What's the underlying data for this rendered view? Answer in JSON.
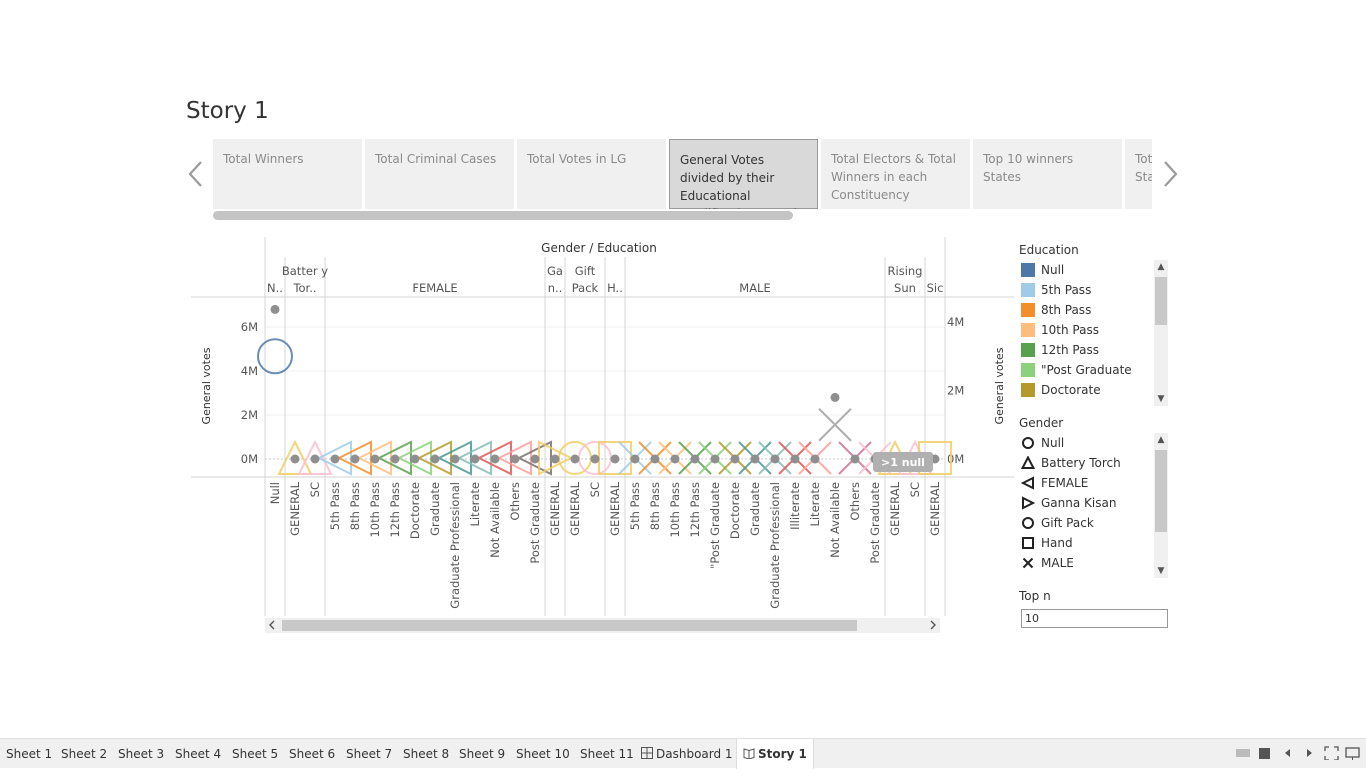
{
  "story": {
    "title": "Story 1",
    "points": [
      {
        "label": "Total Winners"
      },
      {
        "label": "Total Criminal Cases"
      },
      {
        "label": "Total Votes in LG"
      },
      {
        "label": "General Votes divided by their Educational Qualification&Gender"
      },
      {
        "label": " Total Electors & Total Winners in each Constituency"
      },
      {
        "label": "Top 10 winners States"
      },
      {
        "label": "Total General ... States"
      }
    ],
    "active_index": 3
  },
  "viz": {
    "column_header": "Gender / Education",
    "y_axis_label": "General votes",
    "null_badge": ">1 null",
    "gender_groups": [
      {
        "label": "N.."
      },
      {
        "label": "Batter y Tor.."
      },
      {
        "label": "FEMALE"
      },
      {
        "label": "Ga n.."
      },
      {
        "label": "Gift Pack"
      },
      {
        "label": "H.."
      },
      {
        "label": "MALE"
      },
      {
        "label": "Rising Sun"
      },
      {
        "label": "Sic"
      }
    ],
    "categories": [
      "Null",
      "GENERAL",
      "SC",
      "5th Pass",
      "8th Pass",
      "10th Pass",
      "12th Pass",
      "Doctorate",
      "Graduate",
      "Graduate Professional",
      "Literate",
      "Not Available",
      "Others",
      "Post Graduate",
      "GENERAL",
      "GENERAL",
      "SC",
      "GENERAL",
      "5th Pass",
      "8th Pass",
      "10th Pass",
      "12th Pass",
      "\"Post Graduate",
      "Doctorate",
      "Graduate",
      "Graduate Professional",
      "Illiterate",
      "Literate",
      "Not Available",
      "Others",
      "Post Graduate",
      "GENERAL",
      "SC",
      "GENERAL"
    ]
  },
  "chart_data": {
    "type": "scatter",
    "title": "",
    "xlabel": "Gender / Education",
    "ylabel": "General votes",
    "left_axis": {
      "ticks": [
        "0M",
        "2M",
        "4M",
        "6M"
      ],
      "ylim": [
        0,
        7000000
      ]
    },
    "right_axis": {
      "ticks": [
        "0M",
        "2M",
        "4M"
      ],
      "ylim": [
        0,
        4600000
      ]
    },
    "series": [
      {
        "name": "General votes",
        "values": [
          6800000,
          0,
          0,
          0,
          0,
          0,
          0,
          0,
          0,
          0,
          0,
          0,
          0,
          0,
          0,
          0,
          0,
          0,
          0,
          0,
          0,
          0,
          0,
          0,
          0,
          0,
          0,
          0,
          2800000,
          0,
          0,
          0,
          0,
          0
        ]
      },
      {
        "name": "General votes",
        "values": [
          3000000,
          120000,
          120000,
          120000,
          120000,
          120000,
          120000,
          120000,
          120000,
          120000,
          120000,
          120000,
          120000,
          120000,
          120000,
          120000,
          120000,
          100000,
          120000,
          120000,
          120000,
          120000,
          120000,
          120000,
          120000,
          120000,
          120000,
          120000,
          1000000,
          120000,
          120000,
          120000,
          120000,
          100000
        ]
      }
    ],
    "shapes": [
      "circle",
      "triangle",
      "triangle",
      "triangle-left",
      "triangle-left",
      "triangle-left",
      "triangle-left",
      "triangle-left",
      "triangle-left",
      "triangle-left",
      "triangle-left",
      "triangle-left",
      "triangle-left",
      "triangle-left",
      "triangle-right",
      "circle",
      "circle",
      "square",
      "cross",
      "cross",
      "cross",
      "cross",
      "cross",
      "cross",
      "cross",
      "cross",
      "cross",
      "cross",
      "cross",
      "cross",
      "cross",
      "triangle",
      "triangle",
      "square"
    ],
    "colors": [
      "#4e79a7",
      "#f1ce63",
      "#fabfd2",
      "#a0cbe8",
      "#f28e2b",
      "#ffbe7d",
      "#59a14f",
      "#8cd17d",
      "#b6992d",
      "#499894",
      "#86bcb6",
      "#e15759",
      "#ff9d9a",
      "#79706e",
      "#f1ce63",
      "#f1ce63",
      "#fabfd2",
      "#f1ce63",
      "#a0cbe8",
      "#f28e2b",
      "#ffbe7d",
      "#59a14f",
      "#8cd17d",
      "#b6992d",
      "#499894",
      "#86bcb6",
      "#e15759",
      "#ff9d9a",
      "#bab0ac",
      "#d37295",
      "#fabfd2",
      "#f1ce63",
      "#fabfd2",
      "#f1ce63"
    ],
    "group_bounds": [
      [
        0,
        0
      ],
      [
        1,
        2
      ],
      [
        3,
        13
      ],
      [
        14,
        14
      ],
      [
        15,
        16
      ],
      [
        17,
        17
      ],
      [
        18,
        30
      ],
      [
        31,
        32
      ],
      [
        33,
        33
      ]
    ]
  },
  "legend_education": {
    "title": "Education",
    "items": [
      {
        "label": "Null",
        "color": "#4e79a7"
      },
      {
        "label": "5th Pass",
        "color": "#a0cbe8"
      },
      {
        "label": "8th Pass",
        "color": "#f28e2b"
      },
      {
        "label": "10th Pass",
        "color": "#ffbe7d"
      },
      {
        "label": "12th Pass",
        "color": "#59a14f"
      },
      {
        "label": "\"Post Graduate",
        "color": "#8cd17d"
      },
      {
        "label": "Doctorate",
        "color": "#b6992d"
      }
    ]
  },
  "legend_gender": {
    "title": "Gender",
    "items": [
      {
        "label": "Null",
        "shape": "circle"
      },
      {
        "label": "Battery Torch",
        "shape": "triangle"
      },
      {
        "label": "FEMALE",
        "shape": "triangle-left"
      },
      {
        "label": "Ganna Kisan",
        "shape": "triangle-right"
      },
      {
        "label": "Gift Pack",
        "shape": "circle"
      },
      {
        "label": "Hand",
        "shape": "square"
      },
      {
        "label": "MALE",
        "shape": "cross"
      }
    ]
  },
  "topn": {
    "title": "Top n",
    "value": "10"
  },
  "tabs": [
    {
      "label": "Sheet 1"
    },
    {
      "label": "Sheet 2"
    },
    {
      "label": "Sheet 3"
    },
    {
      "label": "Sheet 4"
    },
    {
      "label": "Sheet 5"
    },
    {
      "label": "Sheet 6"
    },
    {
      "label": "Sheet 7"
    },
    {
      "label": "Sheet 8"
    },
    {
      "label": "Sheet 9"
    },
    {
      "label": "Sheet 10"
    },
    {
      "label": "Sheet 11"
    },
    {
      "label": "Dashboard 1",
      "icon": "dashboard-icon"
    },
    {
      "label": "Story 1",
      "icon": "story-icon",
      "active": true
    }
  ]
}
